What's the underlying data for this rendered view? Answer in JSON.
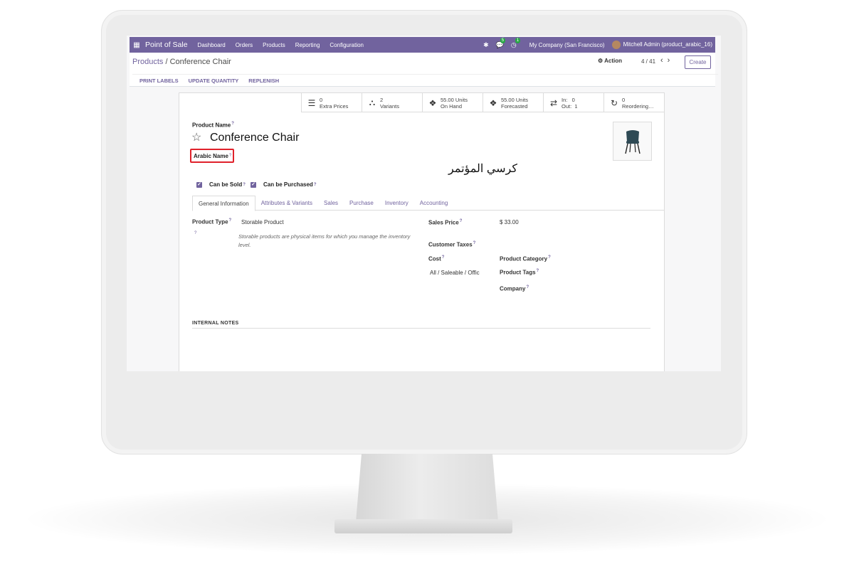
{
  "navbar": {
    "app_name": "Point of Sale",
    "menu": [
      "Dashboard",
      "Orders",
      "Products",
      "Reporting",
      "Configuration"
    ],
    "chat_count": "5",
    "activity_count": "1",
    "company": "My Company (San Francisco)",
    "user": "Mitchell Admin (product_arabic_16)"
  },
  "breadcrumb": {
    "parent": "Products",
    "separator": "/",
    "current": "Conference Chair"
  },
  "controls": {
    "action_label": "Action",
    "pager": "4 / 41",
    "create_label": "Create",
    "buttons": [
      "PRINT LABELS",
      "UPDATE QUANTITY",
      "REPLENISH"
    ]
  },
  "smart_buttons": [
    {
      "icon": "list-icon",
      "glyph": "☰",
      "line1": "0",
      "line2": "Extra Prices"
    },
    {
      "icon": "sitemap-icon",
      "glyph": "⛬",
      "line1": "2",
      "line2": "Variants"
    },
    {
      "icon": "cubes-icon",
      "glyph": "❖",
      "line1": "55.00 Units",
      "line2": "On Hand"
    },
    {
      "icon": "cubes-icon",
      "glyph": "❖",
      "line1": "55.00 Units",
      "line2": "Forecasted"
    },
    {
      "icon": "exchange-icon",
      "glyph": "⇄",
      "line1": "In:   0",
      "line2": "Out:  1"
    },
    {
      "icon": "refresh-icon",
      "glyph": "↻",
      "line1": "0",
      "line2": "Reordering…"
    }
  ],
  "form": {
    "product_name_label": "Product Name",
    "product_name": "Conference Chair",
    "arabic_name_label": "Arabic Name",
    "arabic_name": "كرسي المؤتمر",
    "help_mark": "?",
    "can_be_sold": "Can be Sold",
    "can_be_purchased": "Can be Purchased",
    "tabs": [
      "General Information",
      "Attributes & Variants",
      "Sales",
      "Purchase",
      "Inventory",
      "Accounting"
    ],
    "product_type_label": "Product Type",
    "product_type": "Storable Product",
    "product_type_hint": "Storable products are physical items for which you manage the inventory level.",
    "sales_price_label": "Sales Price",
    "sales_price": "$ 33.00",
    "customer_taxes_label": "Customer Taxes",
    "cost_label": "Cost",
    "category_value": "All / Saleable / Offic",
    "product_category_label": "Product Category",
    "product_tags_label": "Product Tags",
    "company_label": "Company",
    "internal_notes_label": "INTERNAL NOTES"
  }
}
